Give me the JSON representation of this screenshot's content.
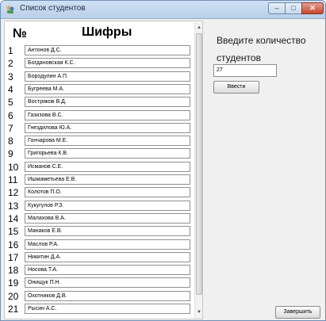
{
  "window": {
    "title": "Список студентов",
    "controls": {
      "minimize": "–",
      "maximize": "□",
      "close": "✕"
    }
  },
  "list": {
    "header_number": "№",
    "header_ciphers": "Шифры",
    "rows": [
      {
        "num": "1",
        "name": "Антонов Д.С."
      },
      {
        "num": "2",
        "name": "Богдановская К.С."
      },
      {
        "num": "3",
        "name": "Бородулин А.П."
      },
      {
        "num": "4",
        "name": "Бугреева М.А."
      },
      {
        "num": "5",
        "name": "Востряков В.Д."
      },
      {
        "num": "6",
        "name": "Газизова В.С."
      },
      {
        "num": "7",
        "name": "Гнездилова Ю.А."
      },
      {
        "num": "8",
        "name": "Гончарова М.Е."
      },
      {
        "num": "9",
        "name": "Григорьева К.В."
      },
      {
        "num": "10",
        "name": "Исманов С.Е."
      },
      {
        "num": "11",
        "name": "Ишмаметьева Е.В."
      },
      {
        "num": "12",
        "name": "Колотов П.О."
      },
      {
        "num": "13",
        "name": "Кукугулов Р.З."
      },
      {
        "num": "14",
        "name": "Малахова В.А."
      },
      {
        "num": "15",
        "name": "Манаков Е.В."
      },
      {
        "num": "16",
        "name": "Маслов Р.А."
      },
      {
        "num": "17",
        "name": "Никитин Д.А."
      },
      {
        "num": "18",
        "name": "Носова Т.А."
      },
      {
        "num": "19",
        "name": "Онищук П.Н."
      },
      {
        "num": "20",
        "name": "Охотников Д.В."
      },
      {
        "num": "21",
        "name": "Рысин А.С."
      }
    ]
  },
  "form": {
    "prompt": "Введите количество студентов",
    "count_value": "27",
    "enter_button": "Ввести",
    "finish_button": "Завершить"
  },
  "colors": {
    "titlebar": "#c4d8ef",
    "close_button": "#c5472f"
  }
}
